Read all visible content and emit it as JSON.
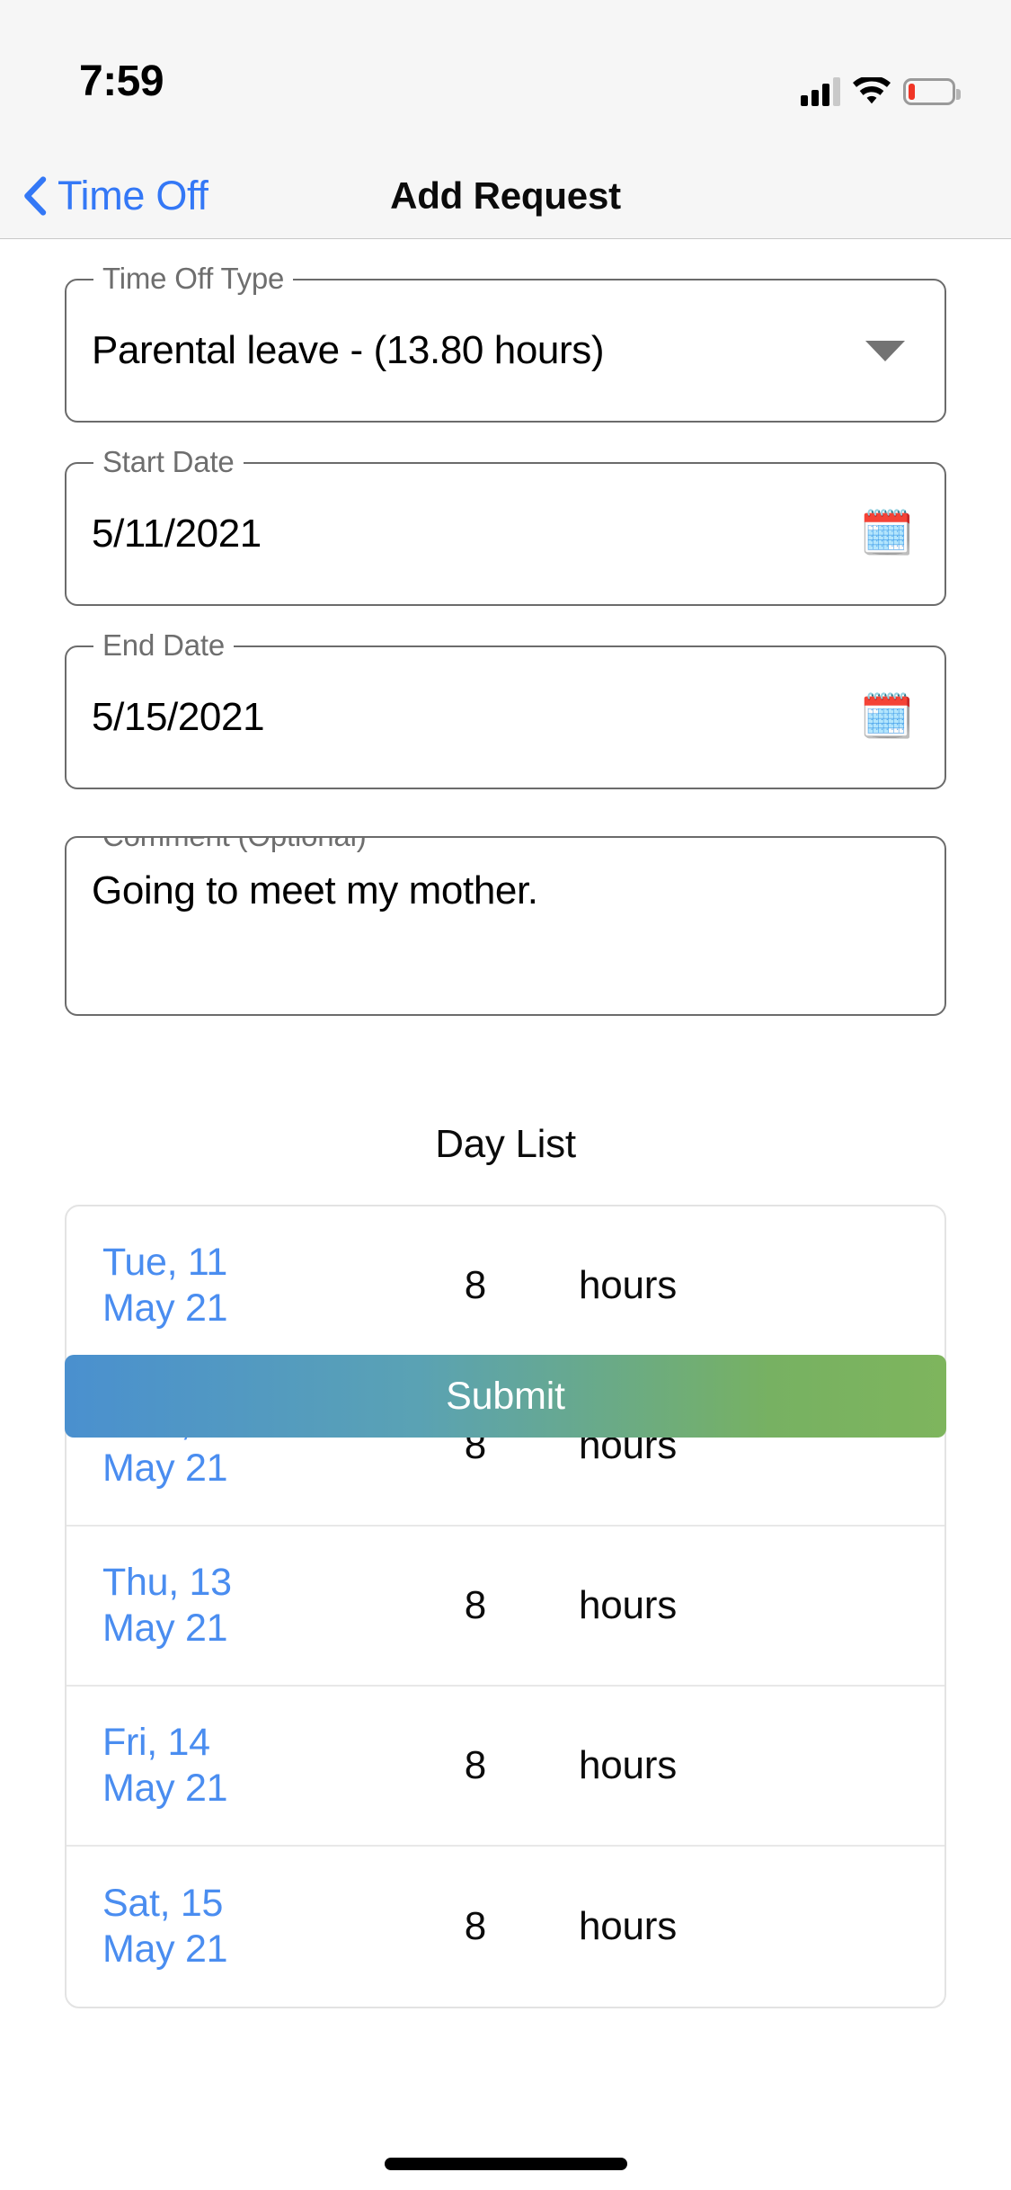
{
  "status_bar": {
    "time": "7:59",
    "icons": [
      "cellular-signal-icon",
      "wifi-icon",
      "battery-low-icon"
    ],
    "battery_color": "#f03526"
  },
  "nav": {
    "back_label": "Time Off",
    "back_icon": "chevron-left-icon",
    "title": "Add Request",
    "accent_color": "#3478f6"
  },
  "form": {
    "time_off_type": {
      "label": "Time Off Type",
      "value": "Parental leave - (13.80 hours)",
      "icon": "chevron-down-icon"
    },
    "start_date": {
      "label": "Start Date",
      "value": "5/11/2021",
      "icon": "calendar-icon",
      "icon_glyph": "🗓️"
    },
    "end_date": {
      "label": "End Date",
      "value": "5/15/2021",
      "icon": "calendar-icon",
      "icon_glyph": "🗓️"
    },
    "comment": {
      "label": "Comment (Optional)",
      "value": "Going to meet my mother.",
      "placeholder": ""
    },
    "submit_label": "Submit",
    "submit_gradient_from": "#4a90cf",
    "submit_gradient_to": "#7eb55d"
  },
  "day_list": {
    "title": "Day List",
    "date_color": "#4a8df0",
    "rows": [
      {
        "date_line1": "Tue, 11",
        "date_line2": "May 21",
        "hours": "8",
        "unit": "hours"
      },
      {
        "date_line1": "Wed, 12",
        "date_line2": "May 21",
        "hours": "8",
        "unit": "hours"
      },
      {
        "date_line1": "Thu, 13",
        "date_line2": "May 21",
        "hours": "8",
        "unit": "hours"
      },
      {
        "date_line1": "Fri, 14",
        "date_line2": "May 21",
        "hours": "8",
        "unit": "hours"
      },
      {
        "date_line1": "Sat, 15",
        "date_line2": "May 21",
        "hours": "8",
        "unit": "hours"
      }
    ]
  }
}
